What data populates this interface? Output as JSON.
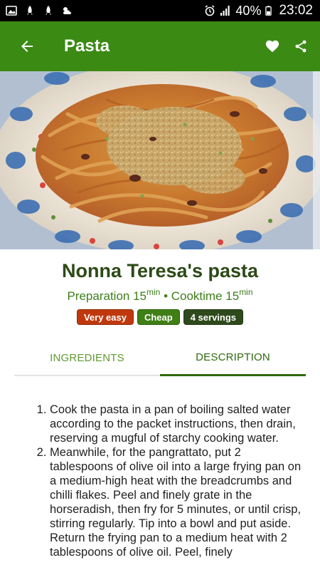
{
  "status_bar": {
    "battery": "40%",
    "time": "23:02",
    "left_icons": [
      "gallery-icon",
      "rocket-icon",
      "rocket-icon",
      "weather-icon"
    ],
    "right_icons": [
      "alarm-icon",
      "signal-icon"
    ]
  },
  "app_bar": {
    "title": "Pasta",
    "back_icon": "back-arrow-icon",
    "favorite_icon": "heart-icon",
    "share_icon": "share-icon",
    "color": "#3a8a14"
  },
  "recipe": {
    "name": "Nonna Teresa's pasta",
    "prep_label": "Preparation 15",
    "prep_unit": "min",
    "separator": " • ",
    "cook_label": "Cooktime 15",
    "cook_unit": "min",
    "badges": [
      {
        "label": "Very easy",
        "color": "#c0390e"
      },
      {
        "label": "Cheap",
        "color": "#3f7f16"
      },
      {
        "label": "4 servings",
        "color": "#2e4a1c"
      }
    ]
  },
  "tabs": [
    {
      "label": "INGREDIENTS",
      "active": false
    },
    {
      "label": "DESCRIPTION",
      "active": true
    }
  ],
  "steps": [
    "Cook the pasta in a pan of boiling salted water according to the packet instructions, then drain, reserving a mugful of starchy cooking water.",
    "Meanwhile, for the pangrattato, put 2 tablespoons of olive oil into a large frying pan on a medium-high heat with the breadcrumbs and chilli flakes. Peel and finely grate in the horseradish, then fry for 5 minutes, or until crisp, stirring regularly. Tip into a bowl and put aside. Return the frying pan to a medium heat with 2 tablespoons of olive oil. Peel, finely"
  ]
}
